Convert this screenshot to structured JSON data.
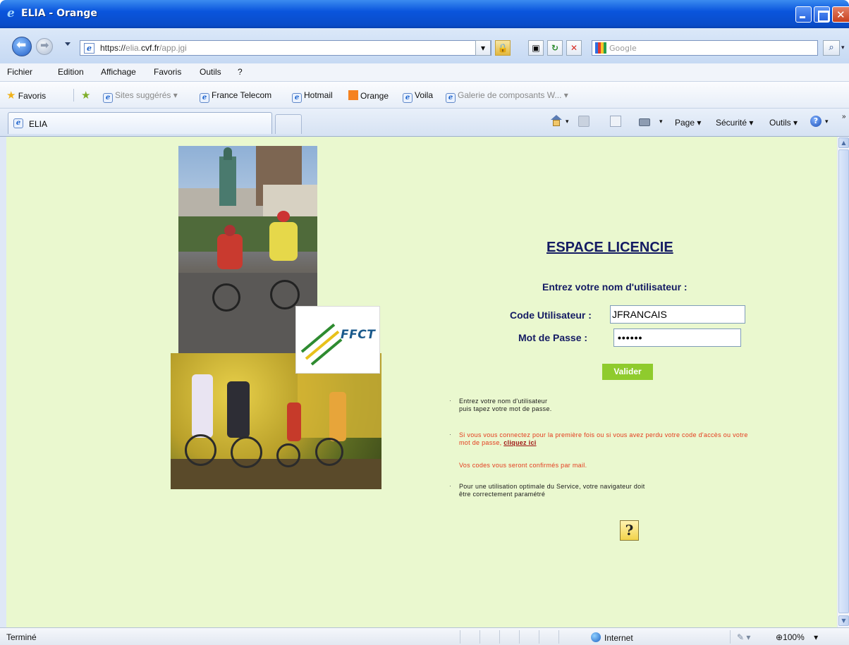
{
  "window": {
    "title": "ELIA - Orange"
  },
  "address": {
    "url_scheme": "https://",
    "url_host_pre": "elia.",
    "url_host_domain": "cvf.fr",
    "url_path": "/app.jgi"
  },
  "search": {
    "placeholder": "Google"
  },
  "menu": {
    "items": [
      "Fichier",
      "Edition",
      "Affichage",
      "Favoris",
      "Outils",
      "?"
    ]
  },
  "favorites": {
    "label": "Favoris",
    "items": [
      "Sites suggérés ▾",
      "France Telecom",
      "Hotmail",
      "Orange",
      "Voila",
      "Galerie de composants W... ▾"
    ]
  },
  "tabs": [
    {
      "label": "ELIA"
    }
  ],
  "commandbar": {
    "page": "Page ▾",
    "security": "Sécurité ▾",
    "tools": "Outils ▾"
  },
  "login": {
    "heading": "ESPACE LICENCIE",
    "subheading": "Entrez votre nom d'utilisateur :",
    "user_label": "Code Utilisateur :",
    "user_value": "JFRANCAIS",
    "password_label": "Mot de Passe :",
    "password_value": "••••••",
    "submit_label": "Valider"
  },
  "logo": {
    "text": "FFCT"
  },
  "notes": {
    "n1_line1": "Entrez votre nom d'utilisateur",
    "n1_line2": "puis tapez votre mot de passe.",
    "n2_line1": "Si vous vous connectez pour la première fois ou si vous avez perdu votre code d'accès ou votre",
    "n2_line2_pre": "mot de passe, ",
    "n2_link": "cliquez ici",
    "n3": "Vos codes vous seront confirmés par mail.",
    "n4_line1": "Pour une utilisation optimale du Service, votre navigateur doit",
    "n4_line2": "être correctement paramétré"
  },
  "help": {
    "label": "?"
  },
  "status": {
    "left": "Terminé",
    "zone": "Internet",
    "zoom": "100%"
  },
  "colors": {
    "page_bg": "#eaf8cf",
    "heading": "#141b63",
    "button": "#8fcb2d",
    "warning": "#e43b1d"
  }
}
